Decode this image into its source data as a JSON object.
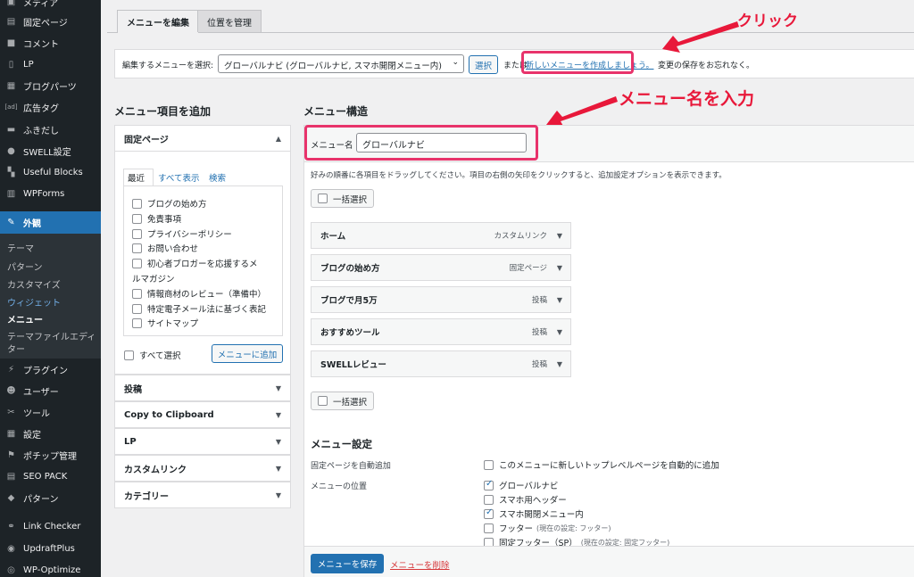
{
  "sidebar": {
    "items": [
      {
        "label": "メディア",
        "icon": "media-icon"
      },
      {
        "label": "固定ページ",
        "icon": "pages-icon"
      },
      {
        "label": "コメント",
        "icon": "comment-icon"
      },
      {
        "label": "LP",
        "icon": "lp-icon"
      },
      {
        "label": "ブログパーツ",
        "icon": "blog-parts-icon"
      },
      {
        "label": "広告タグ",
        "icon": "ad-icon"
      },
      {
        "label": "ふきだし",
        "icon": "balloon-icon"
      },
      {
        "label": "SWELL設定",
        "icon": "swell-icon"
      },
      {
        "label": "Useful Blocks",
        "icon": "blocks-icon"
      },
      {
        "label": "WPForms",
        "icon": "forms-icon"
      },
      {
        "label": "外観",
        "icon": "appearance-icon"
      }
    ],
    "submenu": [
      "テーマ",
      "パターン",
      "カスタマイズ",
      "ウィジェット",
      "メニュー",
      "テーマファイルエディ",
      "ター"
    ],
    "items_after": [
      {
        "label": "プラグイン",
        "icon": "plugin-icon"
      },
      {
        "label": "ユーザー",
        "icon": "user-icon"
      },
      {
        "label": "ツール",
        "icon": "tools-icon"
      },
      {
        "label": "設定",
        "icon": "settings-icon"
      },
      {
        "label": "ポチップ管理",
        "icon": "pochipp-icon"
      },
      {
        "label": "SEO PACK",
        "icon": "seo-icon"
      },
      {
        "label": "パターン",
        "icon": "pattern-icon"
      },
      {
        "label": "Link Checker",
        "icon": "link-icon"
      },
      {
        "label": "UpdraftPlus",
        "icon": "updraft-icon"
      },
      {
        "label": "WP-Optimize",
        "icon": "optimize-icon"
      }
    ]
  },
  "tabs": [
    "メニューを編集",
    "位置を管理"
  ],
  "manage": {
    "label": "編集するメニューを選択:",
    "selected": "グローバルナビ (グローバルナビ, スマホ開閉メニュー内)",
    "select_button": "選択",
    "or": "または",
    "create_link": "新しいメニューを作成しましょう。",
    "tail": "変更の保存をお忘れなく。"
  },
  "annotations": {
    "click": "クリック",
    "enter_name": "メニュー名を入力"
  },
  "left": {
    "heading": "メニュー項目を追加",
    "pages_head": "固定ページ",
    "subtabs": [
      "最近",
      "すべて表示",
      "検索"
    ],
    "pages": [
      "ブログの始め方",
      "免責事項",
      "プライバシーポリシー",
      "お問い合わせ",
      "初心者ブロガーを応援するメ",
      "ルマガジン",
      "情報商材のレビュー（準備中）",
      "特定電子メール法に基づく表記",
      "サイトマップ"
    ],
    "select_all": "すべて選択",
    "add_button": "メニューに追加",
    "accordions": [
      "投稿",
      "Copy to Clipboard",
      "LP",
      "カスタムリンク",
      "カテゴリー"
    ]
  },
  "right": {
    "heading": "メニュー構造",
    "name_label": "メニュー名",
    "name_value": "グローバルナビ",
    "instructions": "好みの順番に各項目をドラッグしてください。項目の右側の矢印をクリックすると、追加設定オプションを表示できます。",
    "bulk_select": "一括選択",
    "items": [
      {
        "title": "ホーム",
        "type": "カスタムリンク"
      },
      {
        "title": "ブログの始め方",
        "type": "固定ページ"
      },
      {
        "title": "ブログで月5万",
        "type": "投稿"
      },
      {
        "title": "おすすめツール",
        "type": "投稿"
      },
      {
        "title": "SWELLレビュー",
        "type": "投稿"
      }
    ],
    "settings_heading": "メニュー設定",
    "auto_add_label": "固定ページを自動追加",
    "auto_add_option": "このメニューに新しいトップレベルページを自動的に追加",
    "location_label": "メニューの位置",
    "locations": [
      {
        "label": "グローバルナビ",
        "note": "",
        "checked": true
      },
      {
        "label": "スマホ用ヘッダー",
        "note": "",
        "checked": false
      },
      {
        "label": "スマホ開閉メニュー内",
        "note": "",
        "checked": true
      },
      {
        "label": "フッター",
        "note": "(現在の設定: フッター)",
        "checked": false
      },
      {
        "label": "固定フッター（SP）",
        "note": "(現在の設定: 固定フッター)",
        "checked": false
      }
    ],
    "save_button": "メニューを保存",
    "delete_link": "メニューを削除"
  }
}
